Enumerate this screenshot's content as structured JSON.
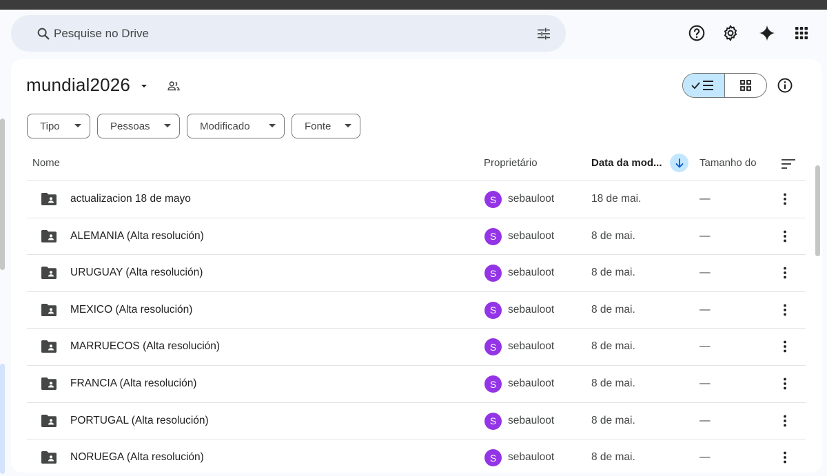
{
  "search": {
    "placeholder": "Pesquise no Drive"
  },
  "header_icons": [
    "help-icon",
    "settings-icon",
    "gemini-icon",
    "apps-icon"
  ],
  "folder": {
    "title": "mundial2026"
  },
  "filters": [
    {
      "label": "Tipo"
    },
    {
      "label": "Pessoas"
    },
    {
      "label": "Modificado"
    },
    {
      "label": "Fonte"
    }
  ],
  "columns": {
    "name": "Nome",
    "owner": "Proprietário",
    "modified": "Data da mod...",
    "size": "Tamanho do"
  },
  "rows": [
    {
      "name": "actualizacion 18 de mayo",
      "owner_initial": "S",
      "owner": "sebauloot",
      "date": "18 de mai.",
      "size": "—"
    },
    {
      "name": "ALEMANIA (Alta resolución)",
      "owner_initial": "S",
      "owner": "sebauloot",
      "date": "8 de mai.",
      "size": "—"
    },
    {
      "name": "URUGUAY (Alta resolución)",
      "owner_initial": "S",
      "owner": "sebauloot",
      "date": "8 de mai.",
      "size": "—"
    },
    {
      "name": "MEXICO (Alta resolución)",
      "owner_initial": "S",
      "owner": "sebauloot",
      "date": "8 de mai.",
      "size": "—"
    },
    {
      "name": "MARRUECOS (Alta resolución)",
      "owner_initial": "S",
      "owner": "sebauloot",
      "date": "8 de mai.",
      "size": "—"
    },
    {
      "name": "FRANCIA (Alta resolución)",
      "owner_initial": "S",
      "owner": "sebauloot",
      "date": "8 de mai.",
      "size": "—"
    },
    {
      "name": "PORTUGAL (Alta resolución)",
      "owner_initial": "S",
      "owner": "sebauloot",
      "date": "8 de mai.",
      "size": "—"
    },
    {
      "name": "NORUEGA (Alta resolución)",
      "owner_initial": "S",
      "owner": "sebauloot",
      "date": "8 de mai.",
      "size": "—"
    }
  ],
  "colors": {
    "accent": "#c2e7ff",
    "avatar": "#9334e6",
    "search_bg": "#e9eef6"
  }
}
